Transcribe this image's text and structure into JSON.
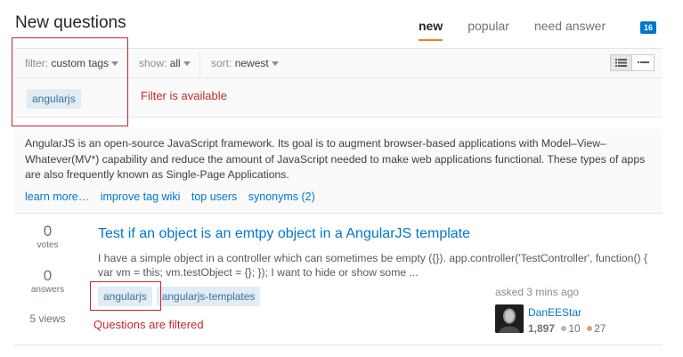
{
  "header": {
    "title": "New questions"
  },
  "tabs": [
    {
      "label": "new",
      "active": true
    },
    {
      "label": "popular",
      "active": false
    },
    {
      "label": "need answer",
      "active": false
    }
  ],
  "tab_count": "16",
  "filters": {
    "filter": {
      "label": "filter:",
      "value": "custom tags"
    },
    "show": {
      "label": "show:",
      "value": "all"
    },
    "sort": {
      "label": "sort:",
      "value": "newest"
    }
  },
  "selected_tag": "angularjs",
  "annotations": {
    "filter_note": "Filter is available",
    "questions_note": "Questions are filtered"
  },
  "tag_wiki": {
    "text": "AngularJS is an open-source JavaScript framework. Its goal is to augment browser-based applications with Model–View–Whatever(MV*) capability and reduce the amount of JavaScript needed to make web applications functional. These types of apps are also frequently known as Single-Page Applications.",
    "links": [
      "learn more…",
      "improve tag wiki",
      "top users",
      "synonyms (2)"
    ]
  },
  "question": {
    "votes": "0",
    "votes_label": "votes",
    "answers": "0",
    "answers_label": "answers",
    "views": "5 views",
    "title": "Test if an object is an emtpy object in a AngularJS template",
    "excerpt": "I have a simple object in a controller which can sometimes be empty ({}). app.controller('TestController', function() { var vm = this; vm.testObject = {}; }); I want to hide or show some ...",
    "tags": [
      "angularjs",
      "angularjs-templates"
    ],
    "asked": "asked 3 mins ago",
    "user": {
      "name": "DanEEStar",
      "rep": "1,897",
      "silver": "10",
      "bronze": "27"
    }
  },
  "colors": {
    "accent": "#f48024",
    "link": "#0077cc",
    "annotation": "#c4282e",
    "tag_bg": "#e1ecf4",
    "silver": "#b4b8bc",
    "bronze": "#d1a684"
  }
}
